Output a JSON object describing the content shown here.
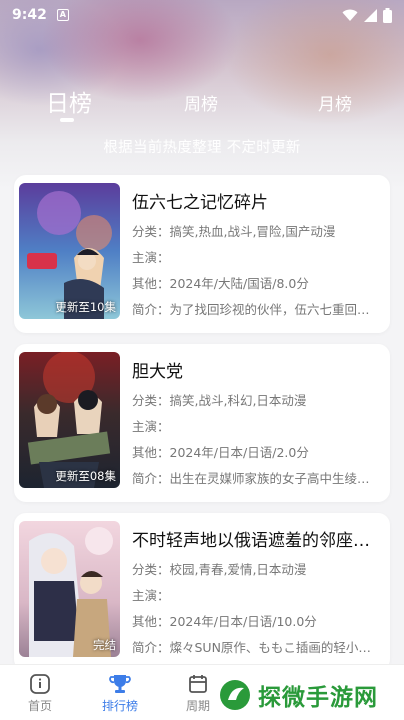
{
  "status": {
    "time": "9:42",
    "notif_letter": "A"
  },
  "tabs": [
    {
      "label": "日榜",
      "active": true
    },
    {
      "label": "周榜",
      "active": false
    },
    {
      "label": "月榜",
      "active": false
    }
  ],
  "subtitle": "根据当前热度整理 不定时更新",
  "items": [
    {
      "title": "伍六七之记忆碎片",
      "genre": "分类：搞笑,热血,战斗,冒险,国产动漫",
      "cast": "主演：",
      "other": "其他：2024年/大陆/国语/8.0分",
      "intro": "简介：为了找回珍视的伙伴，伍六七重回…",
      "badge": "更新至10集"
    },
    {
      "title": "胆大党",
      "genre": "分类：搞笑,战斗,科幻,日本动漫",
      "cast": "主演：",
      "other": "其他：2024年/日本/日语/2.0分",
      "intro": "简介：出生在灵媒师家族的女子高中生绫…",
      "badge": "更新至08集"
    },
    {
      "title": "不时轻声地以俄语遮羞的邻座…",
      "genre": "分类：校园,青春,爱情,日本动漫",
      "cast": "主演：",
      "other": "其他：2024年/日本/日语/10.0分",
      "intro": "简介：燦々SUN原作、ももこ插画的轻小…",
      "badge": "完结"
    }
  ],
  "nav": [
    {
      "label": "首页",
      "icon": "home-icon"
    },
    {
      "label": "排行榜",
      "icon": "trophy-icon",
      "active": true
    },
    {
      "label": "周期",
      "icon": "calendar-icon"
    }
  ],
  "watermark": {
    "text": "探微手游网"
  },
  "colors": {
    "accent": "#3d7de8",
    "watermark_green": "#2a9a3a"
  }
}
